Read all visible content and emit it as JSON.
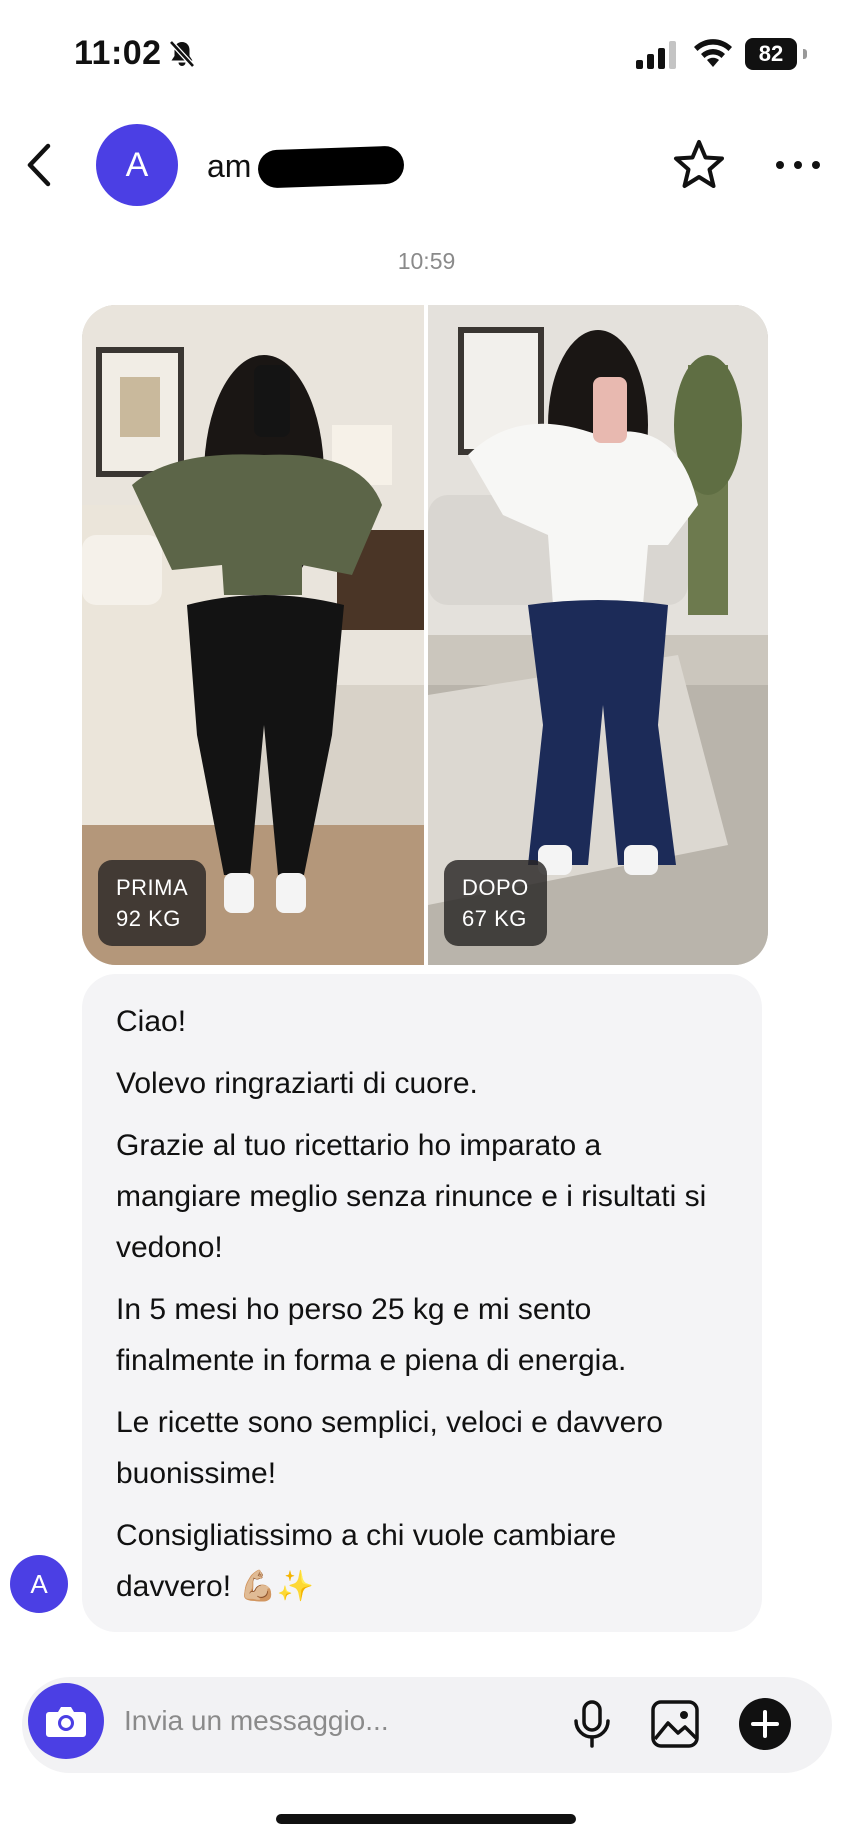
{
  "status_bar": {
    "time": "11:02",
    "battery": "82",
    "icons": [
      "bell-off-icon",
      "signal-icon",
      "wifi-icon",
      "battery-icon"
    ]
  },
  "header": {
    "avatar_letter": "A",
    "contact_name_visible": "am",
    "icons": [
      "back-chevron-icon",
      "star-icon",
      "more-dots-icon"
    ]
  },
  "conversation": {
    "timestamp": "10:59",
    "photo": {
      "before_label": "PRIMA",
      "before_weight": "92 KG",
      "after_label": "DOPO",
      "after_weight": "67 KG"
    },
    "message": {
      "line1": "Ciao!",
      "line2": "Volevo ringraziarti di cuore.",
      "line3": "Grazie al tuo ricettario ho imparato a mangiare meglio senza rinunce e i risultati si vedono!",
      "line4": "In 5 mesi ho perso 25 kg e mi sento finalmente in forma e piena di energia.",
      "line5": "Le ricette sono semplici, veloci e davvero buonissime!",
      "line6": "Consigliatissimo a chi vuole cambiare davvero!",
      "emoji": "💪🏼✨"
    },
    "sender_avatar_letter": "A"
  },
  "composer": {
    "placeholder": "Invia un messaggio...",
    "icons": [
      "camera-icon",
      "microphone-icon",
      "gallery-icon",
      "plus-icon"
    ]
  },
  "colors": {
    "accent": "#4b3fe4",
    "bubble": "#f4f4f6",
    "composer": "#f2f2f4"
  }
}
